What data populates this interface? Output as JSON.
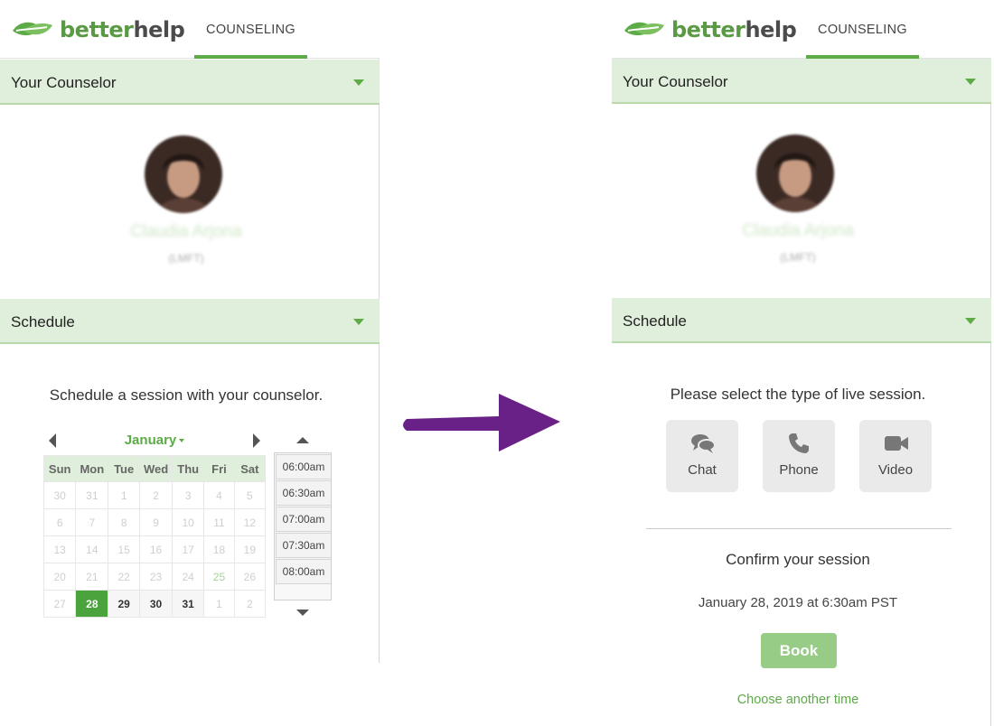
{
  "brand": {
    "logo_light": "better",
    "logo_dark": "help",
    "accent_color": "#5cab46"
  },
  "left": {
    "nav_tab": "COUNSELING",
    "counselor_section": "Your Counselor",
    "counselor_name": "Claudia Arjona",
    "counselor_credential": "(LMFT)",
    "schedule_section": "Schedule",
    "prompt": "Schedule a session with your counselor.",
    "calendar": {
      "month": "January",
      "weekdays": [
        "Sun",
        "Mon",
        "Tue",
        "Wed",
        "Thu",
        "Fri",
        "Sat"
      ],
      "weeks": [
        [
          "30",
          "31",
          "1",
          "2",
          "3",
          "4",
          "5"
        ],
        [
          "6",
          "7",
          "8",
          "9",
          "10",
          "11",
          "12"
        ],
        [
          "13",
          "14",
          "15",
          "16",
          "17",
          "18",
          "19"
        ],
        [
          "20",
          "21",
          "22",
          "23",
          "24",
          "25",
          "26"
        ],
        [
          "27",
          "28",
          "29",
          "30",
          "31",
          "1",
          "2"
        ]
      ],
      "selected_day": "28"
    },
    "time_slots": [
      "06:00am",
      "06:30am",
      "07:00am",
      "07:30am",
      "08:00am"
    ]
  },
  "right": {
    "nav_tab": "COUNSELING",
    "counselor_section": "Your Counselor",
    "counselor_name": "Claudia Arjona",
    "counselor_credential": "(LMFT)",
    "schedule_section": "Schedule",
    "prompt": "Please select the type of live session.",
    "session_types": [
      {
        "label": "Chat",
        "icon": "chat-bubbles-icon"
      },
      {
        "label": "Phone",
        "icon": "phone-icon"
      },
      {
        "label": "Video",
        "icon": "video-camera-icon"
      }
    ],
    "confirm_title": "Confirm your session",
    "confirm_datetime": "January 28, 2019 at 6:30am PST",
    "book_label": "Book",
    "choose_another": "Choose another time"
  },
  "flow_arrow_color": "#6a2187"
}
